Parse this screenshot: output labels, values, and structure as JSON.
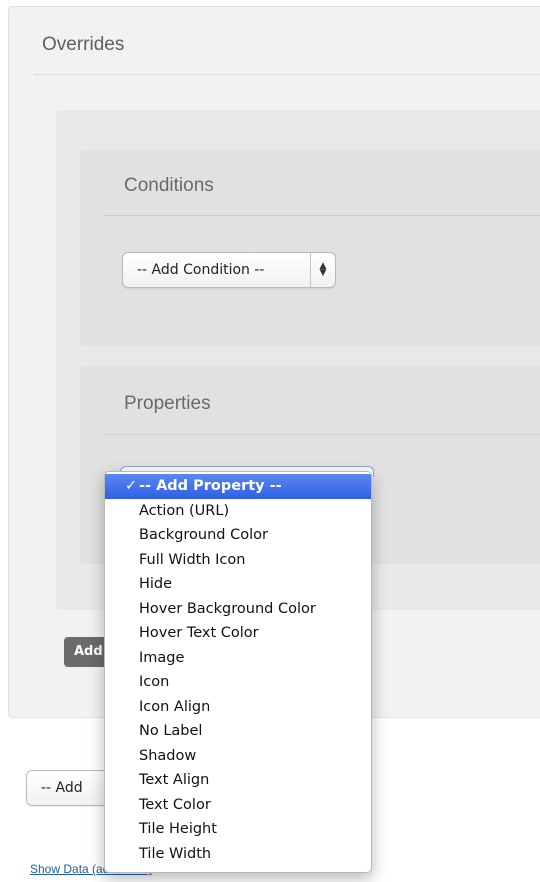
{
  "overrides": {
    "title": "Overrides"
  },
  "conditions": {
    "title": "Conditions",
    "select_value": "-- Add Condition --"
  },
  "properties": {
    "title": "Properties",
    "dropdown": {
      "selected": "-- Add Property --",
      "check_glyph": "✓",
      "options": [
        "Action (URL)",
        "Background Color",
        "Full Width Icon",
        "Hide",
        "Hover Background Color",
        "Hover Text Color",
        "Image",
        "Icon",
        "Icon Align",
        "No Label",
        "Shadow",
        "Text Align",
        "Text Color",
        "Tile Height",
        "Tile Width"
      ]
    }
  },
  "add_group_button": {
    "label": "Add"
  },
  "add_override_select": {
    "value": "-- Add"
  },
  "show_data_link": {
    "label": "Show Data (advanced)"
  },
  "colors": {
    "selection": "#2c60e8",
    "link": "#1f5fb0",
    "button": "#6b6b6b"
  }
}
